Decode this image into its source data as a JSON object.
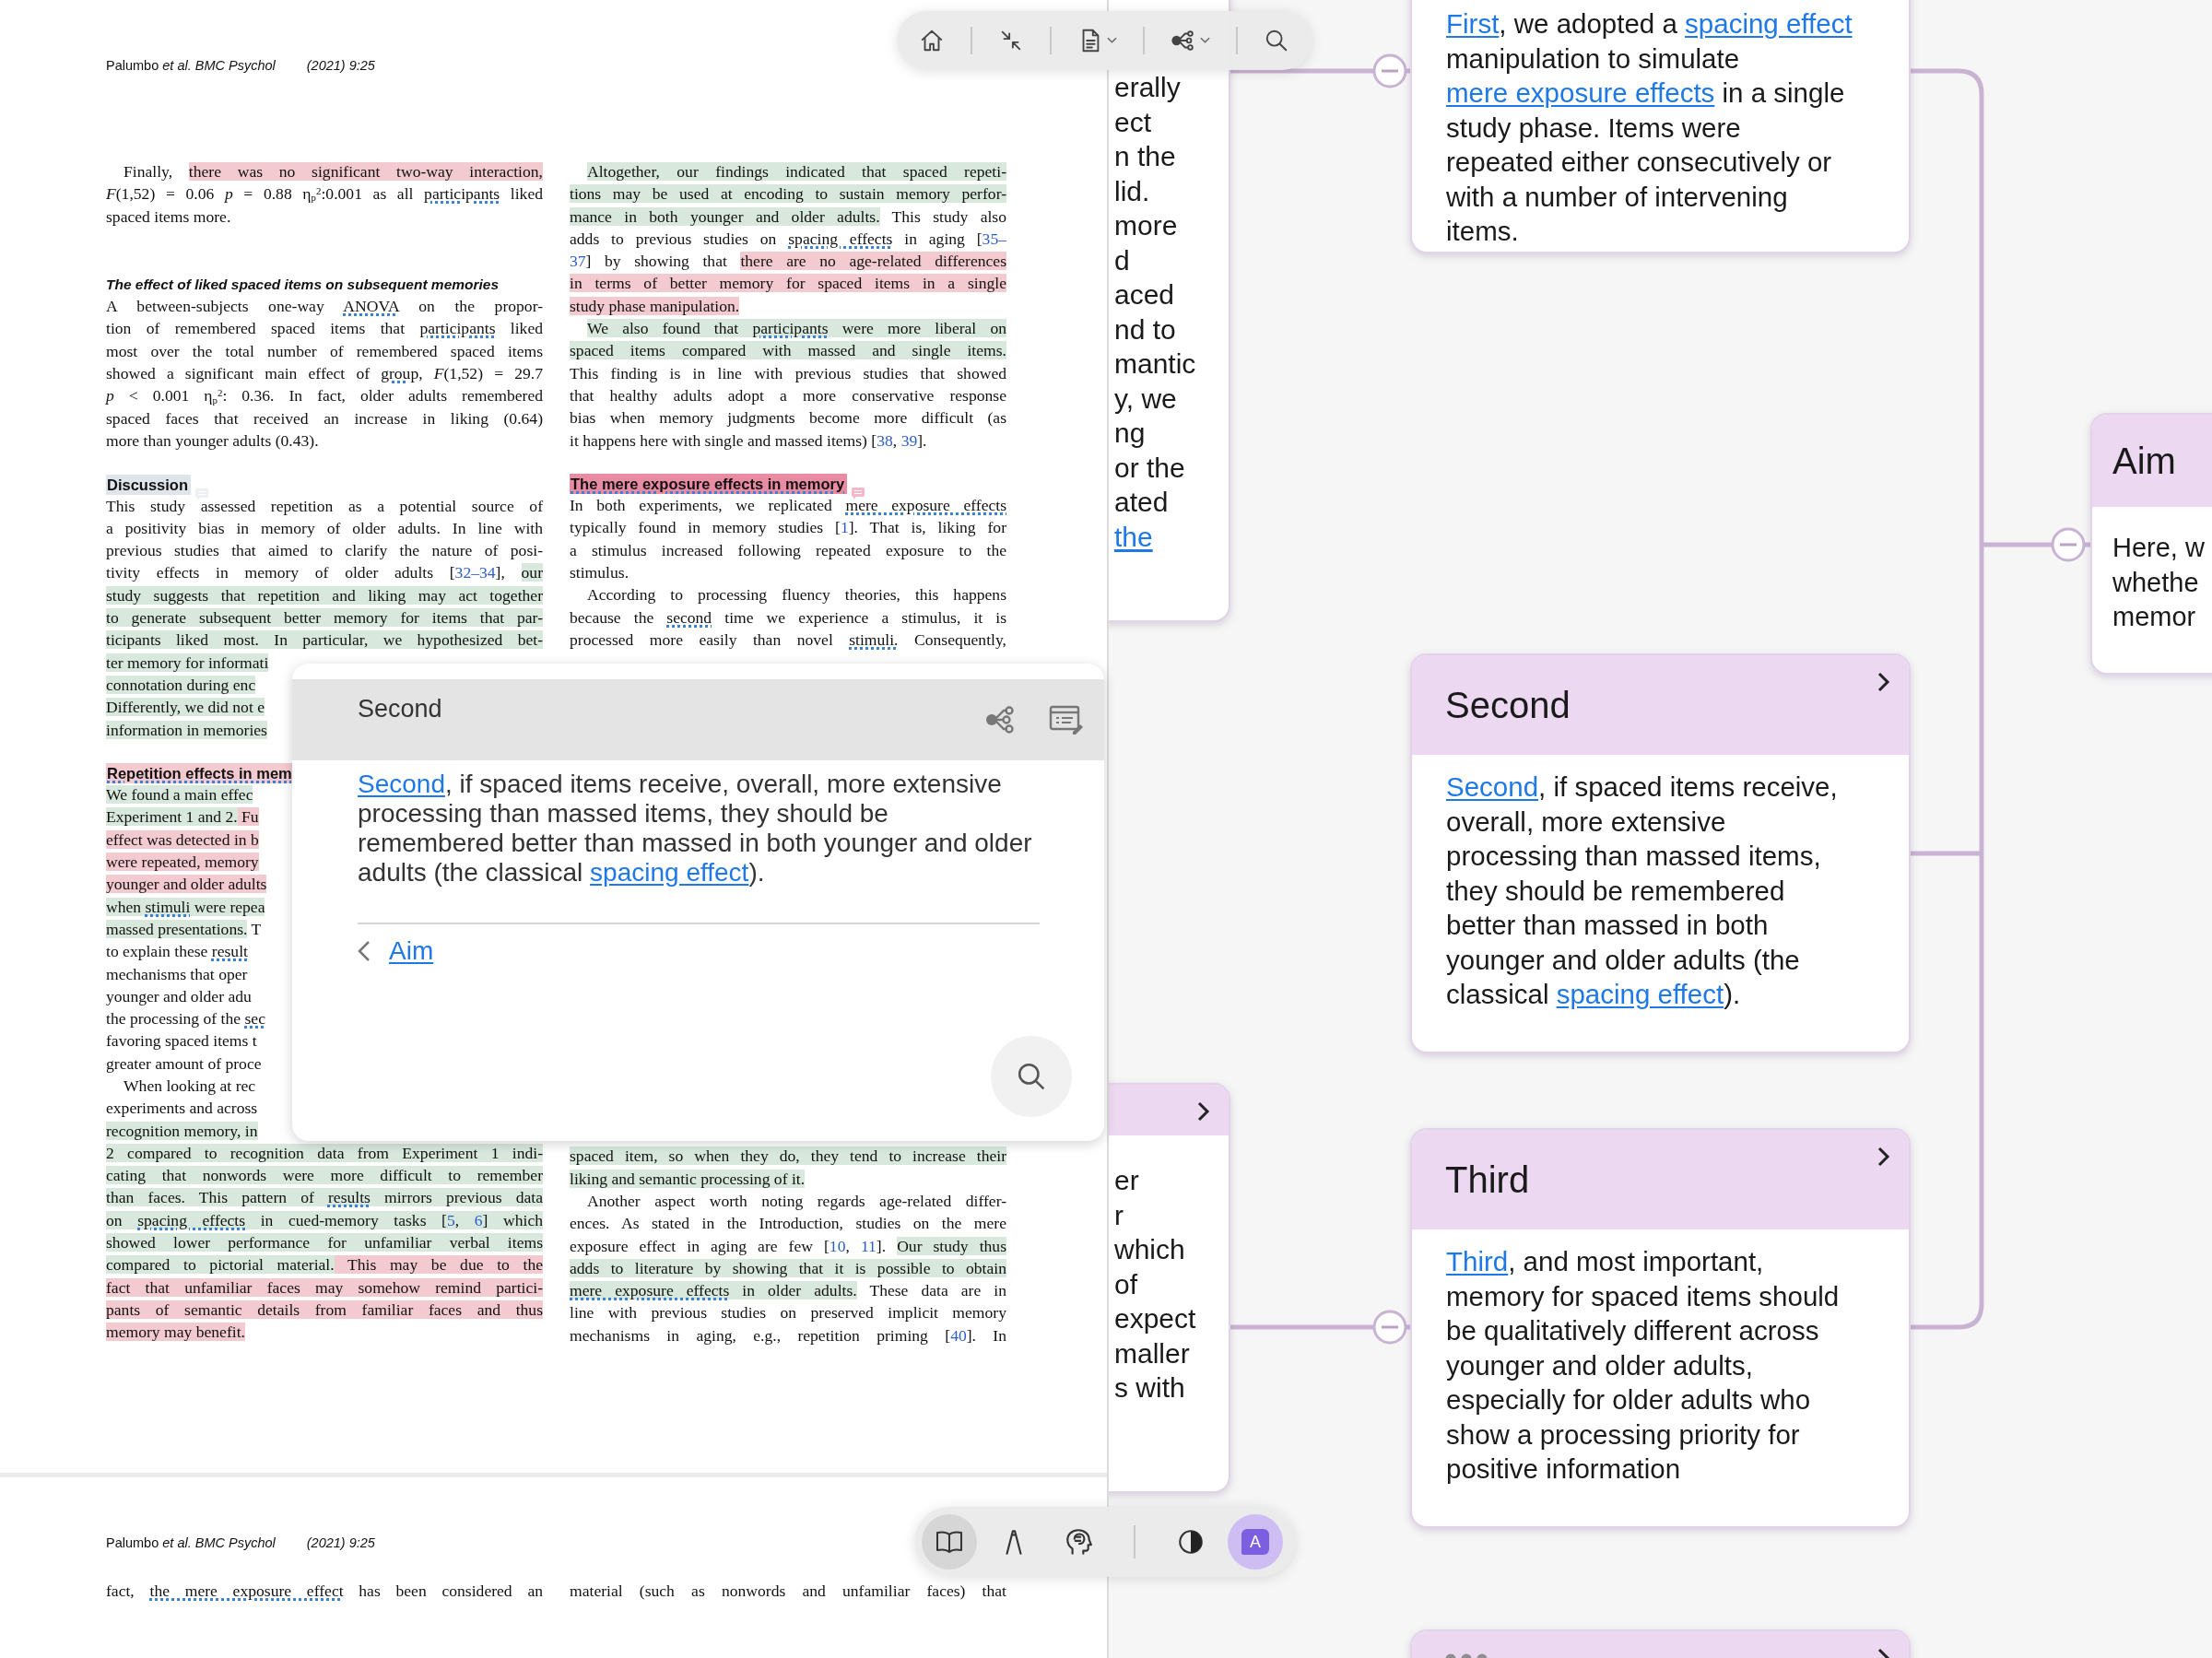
{
  "toolbar_top": {
    "tools": [
      {
        "kind": "home",
        "menu": false
      },
      {
        "kind": "collapse",
        "menu": false
      },
      {
        "kind": "document",
        "menu": true
      },
      {
        "kind": "mindmap",
        "menu": true
      },
      {
        "kind": "search",
        "menu": false
      }
    ]
  },
  "pages": [
    {
      "header": {
        "authors": "Palumbo *et al. BMC Psychol*",
        "citation": "(2021) 9:25"
      },
      "columns": [
        {
          "top": [
            {
              "kind": "paragraph",
              "indent": true,
              "lines": [
                {
                  "segments": [
                    "Finally, ",
                    {
                      "text": "there was no significant two-way interaction,",
                      "color": "#f3cacf"
                    }
                  ]
                },
                {
                  "segments": [
                    "*F*(1,52) = 0.06 *p* = 0.88 η$_{p}$$^{2}$:0.001 as all ",
                    {
                      "text": "participants",
                      "term": true
                    },
                    " liked"
                  ]
                },
                {
                  "segments": [
                    "spaced items more."
                  ]
                }
              ]
            },
            {
              "kind": "subheading",
              "text": "The effect of liked spaced items on subsequent memories"
            },
            {
              "kind": "paragraph",
              "indent": false,
              "lines": [
                {
                  "segments": [
                    "A between-subjects one-way ",
                    {
                      "text": "ANOVA",
                      "term": true
                    },
                    " on the propor-"
                  ]
                },
                {
                  "segments": [
                    "tion of remembered spaced items that ",
                    {
                      "text": "participants",
                      "term": true
                    },
                    " liked"
                  ]
                },
                {
                  "segments": [
                    "most over the total number of remembered spaced items"
                  ]
                },
                {
                  "segments": [
                    "showed a significant main effect of ",
                    {
                      "text": "group,",
                      "term": true
                    },
                    " *F*(1,52) = 29.7"
                  ]
                },
                {
                  "segments": [
                    "*p* < 0.001 η$_{p}$$^{2}$: 0.36. In fact, older adults remembered"
                  ]
                },
                {
                  "segments": [
                    "spaced faces that received an increase in liking (0.64)"
                  ]
                },
                {
                  "segments": [
                    "more than younger adults (0.43)."
                  ]
                }
              ]
            },
            {
              "kind": "heading",
              "text": "Discussion",
              "color": "#dfe5eb",
              "note": true
            },
            {
              "kind": "paragraph",
              "indent": false,
              "lines": [
                {
                  "segments": [
                    "This study assessed repetition as a potential source of"
                  ]
                },
                {
                  "segments": [
                    "a positivity bias in memory of older adults. In line with"
                  ]
                },
                {
                  "segments": [
                    "previous studies that aimed to clarify the nature of posi-"
                  ]
                },
                {
                  "segments": [
                    "tivity effects in memory of older adults [",
                    {
                      "text": "32–34",
                      "citation": true
                    },
                    "], ",
                    {
                      "text": "our",
                      "color": "#d8e8dd"
                    }
                  ]
                },
                {
                  "segments": [
                    {
                      "text": "study suggests that repetition and liking may act together",
                      "color": "#d8e8dd"
                    }
                  ]
                },
                {
                  "segments": [
                    {
                      "text": "to generate subsequent better memory for items that par-",
                      "color": "#d8e8dd"
                    }
                  ]
                },
                {
                  "segments": [
                    {
                      "text": "ticipants liked most. In particular, we hypothesized bet-",
                      "color": "#d8e8dd"
                    }
                  ]
                },
                {
                  "cut": true,
                  "segments": [
                    {
                      "text": "ter memory for informati",
                      "color": "#d8e8dd"
                    }
                  ]
                },
                {
                  "cut": true,
                  "segments": [
                    {
                      "text": "connotation during enc",
                      "color": "#d8e8dd"
                    }
                  ]
                },
                {
                  "cut": true,
                  "segments": [
                    {
                      "text": "Differently, we did not e",
                      "color": "#d8e8dd"
                    }
                  ]
                },
                {
                  "segments": [
                    {
                      "text": "information in memories",
                      "color": "#d8e8dd"
                    }
                  ]
                }
              ]
            },
            {
              "kind": "heading",
              "text": "Repetition effects in mem",
              "color": "#f3cacf",
              "term": true
            },
            {
              "kind": "paragraph",
              "indent": false,
              "lines": [
                {
                  "cut": true,
                  "segments": [
                    {
                      "text": "We found a main effec",
                      "color": "#d8e8dd"
                    }
                  ]
                },
                {
                  "cut": true,
                  "segments": [
                    {
                      "text": "Experiment 1 and 2.",
                      "color": "#d8e8dd"
                    },
                    {
                      "text": " Fu",
                      "color": "#f3cacf"
                    }
                  ]
                },
                {
                  "cut": true,
                  "segments": [
                    {
                      "text": "effect was detected in b",
                      "color": "#f3cacf"
                    }
                  ]
                },
                {
                  "cut": true,
                  "segments": [
                    {
                      "text": "were repeated, memory",
                      "color": "#f3cacf"
                    }
                  ]
                },
                {
                  "cut": true,
                  "segments": [
                    {
                      "text": "younger and older adults",
                      "color": "#f3cacf"
                    }
                  ]
                },
                {
                  "cut": true,
                  "segments": [
                    {
                      "text": "when ",
                      "color": "#d8e8dd"
                    },
                    {
                      "text": "stimuli",
                      "color": "#d8e8dd",
                      "term": true
                    },
                    {
                      "text": " were repea",
                      "color": "#d8e8dd"
                    }
                  ]
                },
                {
                  "cut": true,
                  "segments": [
                    {
                      "text": "massed presentations.",
                      "color": "#d8e8dd"
                    },
                    " T"
                  ]
                },
                {
                  "cut": true,
                  "segments": [
                    "to explain these ",
                    {
                      "text": "result",
                      "term": true
                    }
                  ]
                },
                {
                  "cut": true,
                  "segments": [
                    "mechanisms that oper"
                  ]
                },
                {
                  "cut": true,
                  "segments": [
                    "younger and older adu"
                  ]
                },
                {
                  "cut": true,
                  "segments": [
                    "the processing of the ",
                    {
                      "text": "sec",
                      "term": true
                    }
                  ]
                },
                {
                  "cut": true,
                  "segments": [
                    "favoring spaced items t"
                  ]
                },
                {
                  "segments": [
                    "greater amount of proce"
                  ]
                }
              ]
            },
            {
              "kind": "paragraph",
              "indent": true,
              "lines": [
                {
                  "cut": true,
                  "segments": [
                    "When looking at rec"
                  ]
                },
                {
                  "cut": true,
                  "segments": [
                    "experiments and across"
                  ]
                },
                {
                  "cut": true,
                  "segments": [
                    {
                      "text": "recognition memory, in",
                      "color": "#d8e8dd"
                    }
                  ]
                },
                {
                  "segments": [
                    {
                      "text": "2 compared to recognition data from Experiment 1 indi-",
                      "color": "#d8e8dd"
                    }
                  ]
                },
                {
                  "segments": [
                    {
                      "text": "cating that nonwords were more difficult to remember",
                      "color": "#d8e8dd"
                    }
                  ]
                },
                {
                  "segments": [
                    {
                      "text": "than faces. This pattern of ",
                      "color": "#d8e8dd"
                    },
                    {
                      "text": "results",
                      "color": "#d8e8dd",
                      "term": true
                    },
                    {
                      "text": " mirrors previous data",
                      "color": "#d8e8dd"
                    }
                  ]
                },
                {
                  "segments": [
                    {
                      "text": "on ",
                      "color": "#d8e8dd"
                    },
                    {
                      "text": "spacing effects",
                      "color": "#d8e8dd",
                      "term": true
                    },
                    {
                      "text": " in cued-memory tasks [",
                      "color": "#d8e8dd"
                    },
                    {
                      "text": "5",
                      "color": "#d8e8dd",
                      "citation": true
                    },
                    {
                      "text": ", ",
                      "color": "#d8e8dd"
                    },
                    {
                      "text": "6",
                      "color": "#d8e8dd",
                      "citation": true
                    },
                    {
                      "text": "] which",
                      "color": "#d8e8dd"
                    }
                  ]
                },
                {
                  "segments": [
                    {
                      "text": "showed lower performance for unfamiliar verbal items",
                      "color": "#d8e8dd"
                    }
                  ]
                },
                {
                  "segments": [
                    {
                      "text": "compared to pictorial material.",
                      "color": "#d8e8dd"
                    },
                    {
                      "text": " This may be due to the",
                      "color": "#f3cacf"
                    }
                  ]
                },
                {
                  "segments": [
                    {
                      "text": "fact that unfamiliar faces may somehow remind partici-",
                      "color": "#f3cacf"
                    }
                  ]
                },
                {
                  "segments": [
                    {
                      "text": "pants of semantic details from familiar faces and thus",
                      "color": "#f3cacf"
                    }
                  ]
                },
                {
                  "segments": [
                    {
                      "text": "memory may benefit.",
                      "color": "#f3cacf"
                    }
                  ]
                }
              ]
            }
          ]
        },
        {
          "top": [
            {
              "kind": "paragraph",
              "indent": true,
              "lines": [
                {
                  "segments": [
                    {
                      "text": "Altogether, our findings indicated that spaced repeti-",
                      "color": "#d8e8dd"
                    }
                  ]
                },
                {
                  "segments": [
                    {
                      "text": "tions may be used at encoding to sustain memory perfor-",
                      "color": "#d8e8dd"
                    }
                  ]
                },
                {
                  "segments": [
                    {
                      "text": "mance in both younger and older adults.",
                      "color": "#d8e8dd"
                    },
                    " This study also"
                  ]
                },
                {
                  "segments": [
                    "adds to previous studies on ",
                    {
                      "text": "spacing effects",
                      "term": true
                    },
                    " in aging [",
                    {
                      "text": "35–",
                      "citation": true
                    }
                  ]
                },
                {
                  "segments": [
                    {
                      "text": "37",
                      "citation": true
                    },
                    "] by showing that ",
                    {
                      "text": "there are no age-related differences",
                      "color": "#f3cacf"
                    }
                  ]
                },
                {
                  "segments": [
                    {
                      "text": "in terms of better memory for spaced items in a single",
                      "color": "#f3cacf"
                    }
                  ]
                },
                {
                  "segments": [
                    {
                      "text": "study phase manipulation.",
                      "color": "#f3cacf"
                    }
                  ]
                }
              ]
            },
            {
              "kind": "paragraph",
              "indent": true,
              "lines": [
                {
                  "segments": [
                    {
                      "text": "We also found that ",
                      "color": "#d8e8dd"
                    },
                    {
                      "text": "participants",
                      "color": "#d8e8dd",
                      "term": true
                    },
                    {
                      "text": " were more liberal on",
                      "color": "#d8e8dd"
                    }
                  ]
                },
                {
                  "segments": [
                    {
                      "text": "spaced items compared with massed and single items.",
                      "color": "#d8e8dd"
                    }
                  ]
                },
                {
                  "segments": [
                    "This finding is in line with previous studies that showed"
                  ]
                },
                {
                  "segments": [
                    "that healthy adults adopt a more conservative response"
                  ]
                },
                {
                  "segments": [
                    "bias when memory judgments become more difficult (as"
                  ]
                },
                {
                  "segments": [
                    "it happens here with single and massed items) [",
                    {
                      "text": "38",
                      "citation": true
                    },
                    ", ",
                    {
                      "text": "39",
                      "citation": true
                    },
                    "]."
                  ]
                }
              ]
            },
            {
              "kind": "heading",
              "text": "The mere exposure effects in memory",
              "color": "#e98ba3",
              "term": true,
              "note": true
            },
            {
              "kind": "paragraph",
              "indent": false,
              "lines": [
                {
                  "segments": [
                    "In both experiments, we replicated ",
                    {
                      "text": "mere exposure effects",
                      "term": true
                    }
                  ]
                },
                {
                  "segments": [
                    "typically found in memory studies [",
                    {
                      "text": "1",
                      "citation": true
                    },
                    "]. That is, liking for"
                  ]
                },
                {
                  "segments": [
                    "a stimulus increased following repeated exposure to the"
                  ]
                },
                {
                  "segments": [
                    "stimulus."
                  ]
                }
              ]
            },
            {
              "kind": "paragraph",
              "indent": true,
              "continues": true,
              "lines": [
                {
                  "segments": [
                    "According to processing fluency theories, this happens"
                  ]
                },
                {
                  "segments": [
                    "because the ",
                    {
                      "text": "second",
                      "term": true
                    },
                    " time we experience a stimulus, it is"
                  ]
                },
                {
                  "segments": [
                    "processed more easily than novel ",
                    {
                      "text": "stimuli.",
                      "term": true
                    },
                    " Consequently,"
                  ]
                }
              ]
            }
          ],
          "bottom": [
            {
              "kind": "paragraph",
              "indent": false,
              "lines": [
                {
                  "segments": [
                    {
                      "text": "spaced item, so when they do, they tend to increase their",
                      "color": "#d8e8dd"
                    }
                  ]
                },
                {
                  "segments": [
                    {
                      "text": "liking and semantic processing of it.",
                      "color": "#d8e8dd"
                    }
                  ]
                }
              ]
            },
            {
              "kind": "paragraph",
              "indent": true,
              "continues": true,
              "lines": [
                {
                  "segments": [
                    "Another aspect worth noting regards age-related differ-"
                  ]
                },
                {
                  "segments": [
                    "ences. As stated in the Introduction, studies on the mere"
                  ]
                },
                {
                  "segments": [
                    "exposure effect in aging are few [",
                    {
                      "text": "10",
                      "citation": true
                    },
                    ", ",
                    {
                      "text": "11",
                      "citation": true
                    },
                    "]. ",
                    {
                      "text": "Our study thus",
                      "color": "#d8e8dd"
                    }
                  ]
                },
                {
                  "segments": [
                    {
                      "text": "adds to literature by showing that it is possible to obtain",
                      "color": "#d8e8dd"
                    }
                  ]
                },
                {
                  "segments": [
                    {
                      "text": "mere exposure effects",
                      "color": "#d8e8dd",
                      "term": true
                    },
                    {
                      "text": " in older adults.",
                      "color": "#d8e8dd"
                    },
                    " These data are in"
                  ]
                },
                {
                  "segments": [
                    "line with previous studies on preserved implicit memory"
                  ]
                },
                {
                  "segments": [
                    "mechanisms in aging, e.g., repetition priming [",
                    {
                      "text": "40",
                      "citation": true
                    },
                    "]. In"
                  ]
                }
              ]
            }
          ]
        }
      ]
    },
    {
      "header": {
        "authors": "Palumbo *et al. BMC Psychol*",
        "citation": "(2021) 9:25"
      },
      "columns": [
        {
          "top": [
            {
              "kind": "paragraph",
              "indent": false,
              "continues": true,
              "lines": [
                {
                  "segments": [
                    "fact, ",
                    {
                      "text": "the mere exposure effect",
                      "term": true
                    },
                    " has been considered an"
                  ]
                }
              ]
            }
          ]
        },
        {
          "top": [
            {
              "kind": "paragraph",
              "indent": false,
              "continues": true,
              "lines": [
                {
                  "segments": [
                    "material (such as nonwords and unfamiliar faces) that"
                  ]
                }
              ]
            }
          ]
        }
      ]
    }
  ],
  "popup": {
    "title": "Second",
    "body": [
      {
        "text": "Second",
        "link": true
      },
      ", if spaced items receive, overall, more extensive processing than massed items, they should be remembered better than massed in both younger and older adults (the classical ",
      {
        "text": "spacing effect",
        "link": true
      },
      ")."
    ],
    "back_link": "Aim"
  },
  "mindmap": {
    "nodes": [
      {
        "kind": "fragment",
        "expandable": false,
        "lines": [
          {
            "text": "erally"
          },
          {
            "text": "ect"
          },
          {
            "text": "n the"
          },
          {
            "text": "lid."
          },
          {
            "text": "more"
          },
          {
            "text": "d"
          },
          {
            "text": "aced"
          },
          {
            "text": "nd to"
          },
          {
            "text": "mantic"
          },
          {
            "text": "y, we"
          },
          {
            "text": "ng"
          },
          {
            "text": "or the"
          },
          {
            "text": "ated"
          },
          {
            "text": "the",
            "link": true
          }
        ]
      },
      {
        "kind": "fragment",
        "expandable": true,
        "lines": [
          {
            "text": "er"
          },
          {
            "text": "r"
          },
          {
            "text": "which"
          },
          {
            "text": "of"
          },
          {
            "text": "expect"
          },
          {
            "text": "maller"
          },
          {
            "text": "s with"
          }
        ]
      },
      {
        "kind": "card",
        "body": [
          {
            "text": "First",
            "link": true
          },
          ", we adopted a ",
          {
            "text": "spacing effect",
            "link": true
          },
          " manipulation to simulate ",
          {
            "text": "mere exposure effects",
            "link": true
          },
          " in a single study phase. Items were repeated either consecutively or with a number of intervening items."
        ]
      },
      {
        "kind": "card",
        "title": "Second",
        "expandable": true,
        "body": [
          {
            "text": "Second",
            "link": true
          },
          ", if spaced items receive, overall, more extensive processing than massed items, they should be remembered better than massed in both younger and older adults (the classical ",
          {
            "text": "spacing effect",
            "link": true
          },
          ")."
        ]
      },
      {
        "kind": "card",
        "title": "Third",
        "expandable": true,
        "body": [
          {
            "text": "Third",
            "link": true
          },
          ", and most important, memory for spaced items should be qualitatively different across younger and older adults, especially for older adults who show a processing priority for positive information"
        ]
      },
      {
        "kind": "more",
        "expandable": true
      },
      {
        "kind": "clipped_card",
        "title": "Aim",
        "lines": [
          "Here, w",
          "whethe",
          "memor"
        ]
      }
    ]
  },
  "toolbar_bottom": {
    "tools": [
      {
        "kind": "book",
        "on": true,
        "separated": false
      },
      {
        "kind": "pen",
        "on": false,
        "separated": false
      },
      {
        "kind": "brain",
        "on": false,
        "separated": false
      },
      {
        "kind": "contrast",
        "on": false,
        "separated": true
      },
      {
        "kind": "translate",
        "on": true,
        "separated": false,
        "label": "A"
      }
    ]
  }
}
